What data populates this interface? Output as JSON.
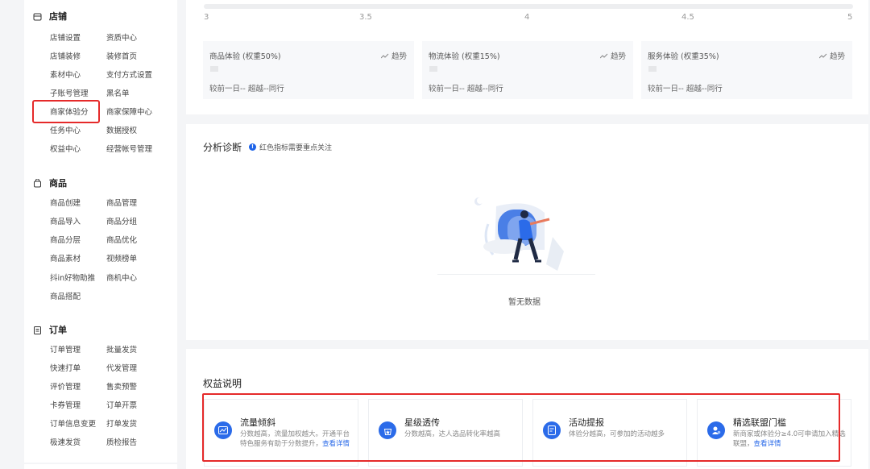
{
  "sidebar": {
    "sections": [
      {
        "icon": "store-icon",
        "title": "店铺",
        "rows": [
          [
            "店铺设置",
            "资质中心"
          ],
          [
            "店铺装修",
            "装修首页"
          ],
          [
            "素材中心",
            "支付方式设置"
          ],
          [
            "子账号管理",
            "黑名单"
          ],
          [
            "商家体验分",
            "商家保障中心"
          ],
          [
            "任务中心",
            "数据授权"
          ],
          [
            "权益中心",
            "经营帐号管理"
          ]
        ]
      },
      {
        "icon": "product-bag-icon",
        "title": "商品",
        "rows": [
          [
            "商品创建",
            "商品管理"
          ],
          [
            "商品导入",
            "商品分组"
          ],
          [
            "商品分层",
            "商品优化"
          ],
          [
            "商品素材",
            "视频榜单"
          ],
          [
            "抖in好物助推",
            "商机中心"
          ],
          [
            "商品搭配",
            ""
          ]
        ]
      },
      {
        "icon": "order-clipboard-icon",
        "title": "订单",
        "rows": [
          [
            "订单管理",
            "批量发货"
          ],
          [
            "快速打单",
            "代发管理"
          ],
          [
            "评价管理",
            "售卖预警"
          ],
          [
            "卡券管理",
            "订单开票"
          ],
          [
            "订单信息变更",
            "打单发货"
          ],
          [
            "极速发货",
            "质检报告"
          ]
        ]
      }
    ],
    "highlighted_item": "商家体验分"
  },
  "score_scale": {
    "ticks": [
      "3",
      "3.5",
      "4",
      "4.5",
      "5"
    ]
  },
  "metrics": [
    {
      "title": "商品体验 (权重50%)",
      "trend_label": "趋势",
      "compare": "较前一日-- 超越--同行"
    },
    {
      "title": "物流体验 (权重15%)",
      "trend_label": "趋势",
      "compare": "较前一日-- 超越--同行"
    },
    {
      "title": "服务体验 (权重35%)",
      "trend_label": "趋势",
      "compare": "较前一日-- 超越--同行"
    }
  ],
  "analysis": {
    "title": "分析诊断",
    "tip_icon": "!",
    "tip": "红色指标需要重点关注",
    "empty_text": "暂无数据"
  },
  "benefits": {
    "title": "权益说明",
    "link_label": "查看详情",
    "items": [
      {
        "icon": "traffic-chart-icon",
        "name": "流量倾斜",
        "desc": "分数越高，流量加权越大。开通平台特色服务有助于分数提升，"
      },
      {
        "icon": "star-bag-icon",
        "name": "星级透传",
        "desc": "分数越高，达人选品转化率越高"
      },
      {
        "icon": "activity-doc-icon",
        "name": "活动提报",
        "desc": "体验分越高，可参加的活动越多"
      },
      {
        "icon": "alliance-user-icon",
        "name": "精选联盟门槛",
        "desc": "新商家或体验分≥4.0可申请加入精选联盟，"
      }
    ]
  },
  "colors": {
    "accent": "#2b6be9",
    "highlight": "#e52a2a"
  }
}
